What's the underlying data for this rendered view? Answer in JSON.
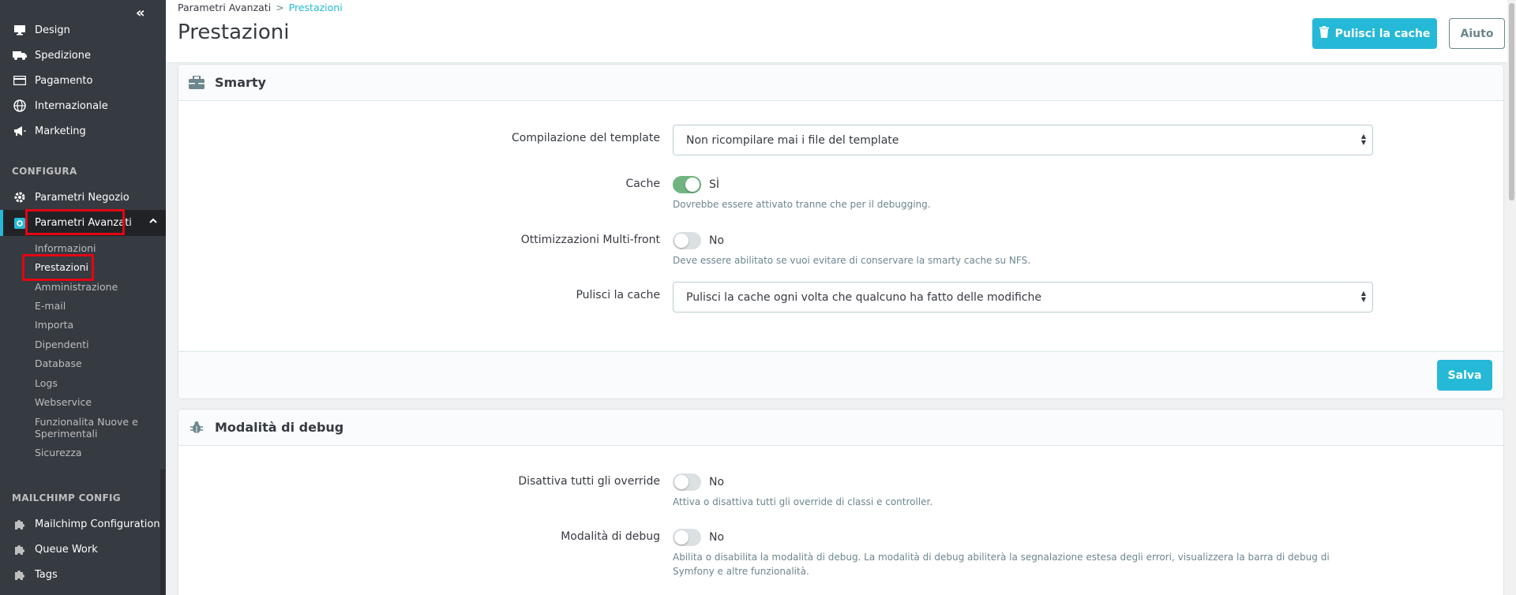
{
  "sidebar": {
    "items_top": [
      {
        "label": "Design",
        "icon": "monitor-icon"
      },
      {
        "label": "Spedizione",
        "icon": "truck-icon"
      },
      {
        "label": "Pagamento",
        "icon": "credit-card-icon"
      },
      {
        "label": "Internazionale",
        "icon": "globe-icon"
      },
      {
        "label": "Marketing",
        "icon": "megaphone-icon"
      }
    ],
    "section_configura": "CONFIGURA",
    "items_config": [
      {
        "label": "Parametri Negozio",
        "icon": "gear-icon"
      },
      {
        "label": "Parametri Avanzati",
        "icon": "settings-box-icon"
      }
    ],
    "sub_items": [
      "Informazioni",
      "Prestazioni",
      "Amministrazione",
      "E-mail",
      "Importa",
      "Dipendenti",
      "Database",
      "Logs",
      "Webservice",
      "Funzionalita Nuove e Sperimentali",
      "Sicurezza"
    ],
    "section_mailchimp": "MAILCHIMP CONFIG",
    "items_mailchimp": [
      {
        "label": "Mailchimp Configuration",
        "icon": "puzzle-icon"
      },
      {
        "label": "Queue Work",
        "icon": "puzzle-icon"
      },
      {
        "label": "Tags",
        "icon": "puzzle-icon"
      }
    ]
  },
  "header": {
    "breadcrumb_parent": "Parametri Avanzati",
    "breadcrumb_sep": ">",
    "breadcrumb_current": "Prestazioni",
    "title": "Prestazioni",
    "btn_cache": "Pulisci la cache",
    "btn_help": "Aiuto"
  },
  "smarty": {
    "title": "Smarty",
    "compile_label": "Compilazione del template",
    "compile_value": "Non ricompilare mai i file del template",
    "cache_label": "Cache",
    "cache_state": "SÌ",
    "cache_help": "Dovrebbe essere attivato tranne che per il debugging.",
    "multifront_label": "Ottimizzazioni Multi-front",
    "multifront_state": "No",
    "multifront_help": "Deve essere abilitato se vuoi evitare di conservare la smarty cache su NFS.",
    "clear_label": "Pulisci la cache",
    "clear_value": "Pulisci la cache ogni volta che qualcuno ha fatto delle modifiche",
    "save": "Salva"
  },
  "debug": {
    "title": "Modalità di debug",
    "override_label": "Disattiva tutti gli override",
    "override_state": "No",
    "override_help": "Attiva o disattiva tutti gli override di classi e controller.",
    "debug_label": "Modalità di debug",
    "debug_state": "No",
    "debug_help": "Abilita o disabilita la modalità di debug. La modalità di debug abiliterà la segnalazione estesa degli errori, visualizzera la barra di debug di Symfony e altre funzionalità."
  },
  "colors": {
    "accent": "#25b9d7",
    "sidebar": "#363a41",
    "switch_on": "#70b580",
    "highlight": "#e30613"
  }
}
